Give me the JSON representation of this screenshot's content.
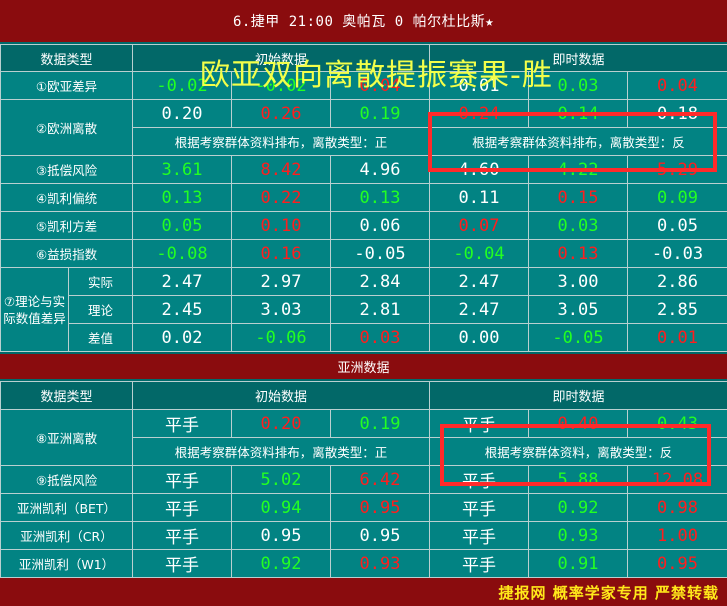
{
  "header": {
    "title": "6.捷甲 21:00  奥帕瓦 0 帕尔杜比斯★"
  },
  "overlay_text": "欧亚双向离散提振赛果-胜",
  "europe": {
    "col_type": "数据类型",
    "col_initial": "初始数据",
    "col_live": "即时数据",
    "rows": {
      "odds_diff": {
        "label": "①欧亚差异",
        "vals": [
          "-0.02",
          "-0.02",
          "0.04",
          "0.01",
          "0.03",
          "0.04"
        ]
      },
      "euro_disc": {
        "label": "②欧洲离散",
        "vals": [
          "0.20",
          "0.26",
          "0.19",
          "0.24",
          "0.14",
          "0.18"
        ],
        "note_initial": "根据考察群体资料排布，离散类型：正",
        "note_live": "根据考察群体资料排布，离散类型：反"
      },
      "compensate": {
        "label": "③抵偿风险",
        "vals": [
          "3.61",
          "8.42",
          "4.96",
          "4.60",
          "4.22",
          "5.29"
        ]
      },
      "kelly_bias": {
        "label": "④凯利偏统",
        "vals": [
          "0.13",
          "0.22",
          "0.13",
          "0.11",
          "0.15",
          "0.09"
        ]
      },
      "kelly_var": {
        "label": "⑤凯利方差",
        "vals": [
          "0.05",
          "0.10",
          "0.06",
          "0.07",
          "0.03",
          "0.05"
        ]
      },
      "profit": {
        "label": "⑥益损指数",
        "vals": [
          "-0.08",
          "0.16",
          "-0.05",
          "-0.04",
          "0.13",
          "-0.03"
        ]
      },
      "theory": {
        "label": "⑦理论与实际数值差异",
        "sub": [
          {
            "label": "实际",
            "vals": [
              "2.47",
              "2.97",
              "2.84",
              "2.47",
              "3.00",
              "2.86"
            ]
          },
          {
            "label": "理论",
            "vals": [
              "2.45",
              "3.03",
              "2.81",
              "2.47",
              "3.05",
              "2.85"
            ]
          },
          {
            "label": "差值",
            "vals": [
              "0.02",
              "-0.06",
              "0.03",
              "0.00",
              "-0.05",
              "0.01"
            ]
          }
        ]
      }
    }
  },
  "asia": {
    "band_title": "亚洲数据",
    "col_type": "数据类型",
    "col_initial": "初始数据",
    "col_live": "即时数据",
    "rows": {
      "asia_disc": {
        "label": "⑧亚洲离散",
        "vals": [
          "平手",
          "0.20",
          "0.19",
          "平手",
          "0.40",
          "0.43"
        ],
        "note_initial": "根据考察群体资料排布，离散类型：正",
        "note_live": "根据考察群体资料，离散类型：反"
      },
      "compensate": {
        "label": "⑨抵偿风险",
        "vals": [
          "平手",
          "5.02",
          "6.42",
          "平手",
          "5.88",
          "12.08"
        ]
      },
      "kelly_bet": {
        "label": "亚洲凯利（BET）",
        "vals": [
          "平手",
          "0.94",
          "0.95",
          "平手",
          "0.92",
          "0.98"
        ]
      },
      "kelly_cr": {
        "label": "亚洲凯利（CR）",
        "vals": [
          "平手",
          "0.95",
          "0.95",
          "平手",
          "0.93",
          "1.00"
        ]
      },
      "kelly_w1": {
        "label": "亚洲凯利（W1）",
        "vals": [
          "平手",
          "0.92",
          "0.93",
          "平手",
          "0.91",
          "0.95"
        ]
      }
    }
  },
  "footer": {
    "text": "捷报网 概率学家专用 严禁转载"
  },
  "colors": {
    "teal": "#028383",
    "dark_red": "#8a0c0e",
    "red": "#ff1e1e",
    "green": "#22ff22",
    "highlight": "#ff2a2a",
    "overlay": "#f3ff4a"
  }
}
